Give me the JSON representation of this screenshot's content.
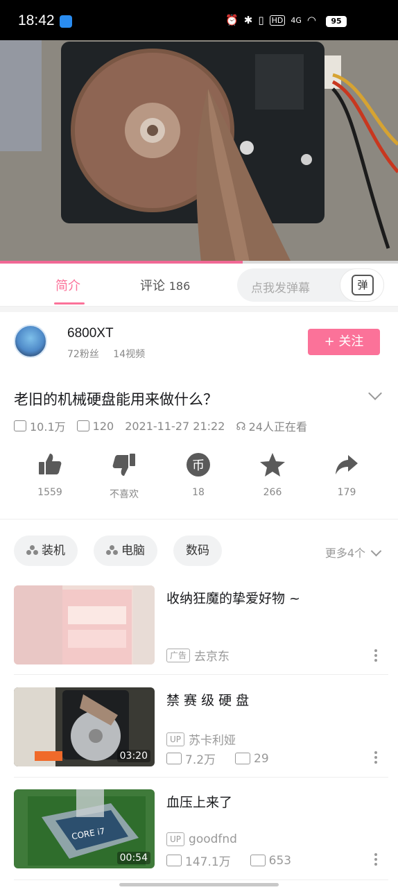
{
  "status_bar": {
    "time": "18:42",
    "battery": "95",
    "network": "4G",
    "hd": "HD"
  },
  "video": {
    "progress": 0.61
  },
  "tabs": {
    "intro": "简介",
    "comments_label": "评论",
    "comments_count": "186"
  },
  "danmaku": {
    "placeholder": "点我发弹幕",
    "button_label": "弹"
  },
  "author": {
    "name": "6800XT",
    "fans": "72粉丝",
    "videos": "14视频",
    "follow_label": "+ 关注"
  },
  "video_info": {
    "title": "老旧的机械硬盘能用来做什么？",
    "views": "10.1万",
    "danmaku_count": "120",
    "date": "2021-11-27 21:22",
    "watching": "24人正在看"
  },
  "actions": [
    {
      "name": "like",
      "label": "1559"
    },
    {
      "name": "dislike",
      "label": "不喜欢"
    },
    {
      "name": "coin",
      "label": "18"
    },
    {
      "name": "favorite",
      "label": "266"
    },
    {
      "name": "share",
      "label": "179"
    }
  ],
  "tags": [
    "装机",
    "电脑",
    "数码"
  ],
  "tags_more": "更多4个",
  "recommendations": [
    {
      "title": "收纳狂魔的挚爱好物 ~",
      "ad_badge": "广告",
      "ad_text": "去京东"
    },
    {
      "title": "禁 赛 级 硬 盘",
      "duration": "03:20",
      "up_badge": "UP",
      "uploader": "苏卡利娅",
      "views": "7.2万",
      "danmaku": "29"
    },
    {
      "title": "血压上来了",
      "duration": "00:54",
      "up_badge": "UP",
      "uploader": "goodfnd",
      "views": "147.1万",
      "danmaku": "653"
    }
  ],
  "colors": {
    "accent": "#fb7299",
    "progress": "#f16895"
  }
}
